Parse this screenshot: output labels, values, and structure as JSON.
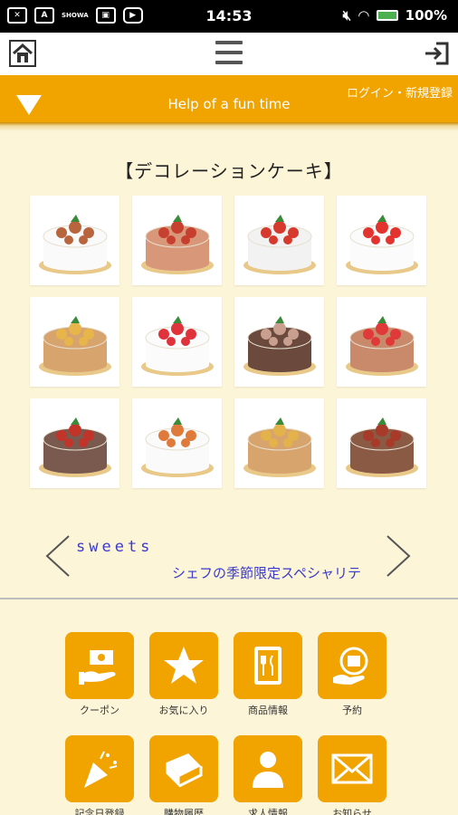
{
  "status_bar": {
    "time": "14:53",
    "battery": "100%",
    "small_label": "SHOWA"
  },
  "header": {
    "tagline": "Help of a fun time",
    "login_label": "ログイン・新規登録"
  },
  "main": {
    "section_title": "【デコレーションケーキ】",
    "cakes": [
      {
        "name": "cake-1"
      },
      {
        "name": "cake-2"
      },
      {
        "name": "cake-3"
      },
      {
        "name": "cake-4"
      },
      {
        "name": "cake-5"
      },
      {
        "name": "cake-6"
      },
      {
        "name": "cake-7"
      },
      {
        "name": "cake-8"
      },
      {
        "name": "cake-9"
      },
      {
        "name": "cake-10"
      },
      {
        "name": "cake-11"
      },
      {
        "name": "cake-12"
      }
    ]
  },
  "carousel": {
    "sweets_label": "sweets",
    "caption": "シェフの季節限定スペシャリテ"
  },
  "menu": {
    "items": [
      {
        "label": "クーポン",
        "icon": "coupon-icon"
      },
      {
        "label": "お気に入り",
        "icon": "star-icon"
      },
      {
        "label": "商品情報",
        "icon": "menu-book-icon"
      },
      {
        "label": "予約",
        "icon": "reservation-icon"
      },
      {
        "label": "記念日登録",
        "icon": "party-popper-icon"
      },
      {
        "label": "購物履歴",
        "icon": "history-book-icon"
      },
      {
        "label": "求人情報",
        "icon": "person-icon"
      },
      {
        "label": "お知らせ",
        "icon": "mail-icon"
      }
    ]
  },
  "colors": {
    "accent": "#f1a300",
    "background": "#fdf5d8",
    "link": "#3a3acd"
  }
}
